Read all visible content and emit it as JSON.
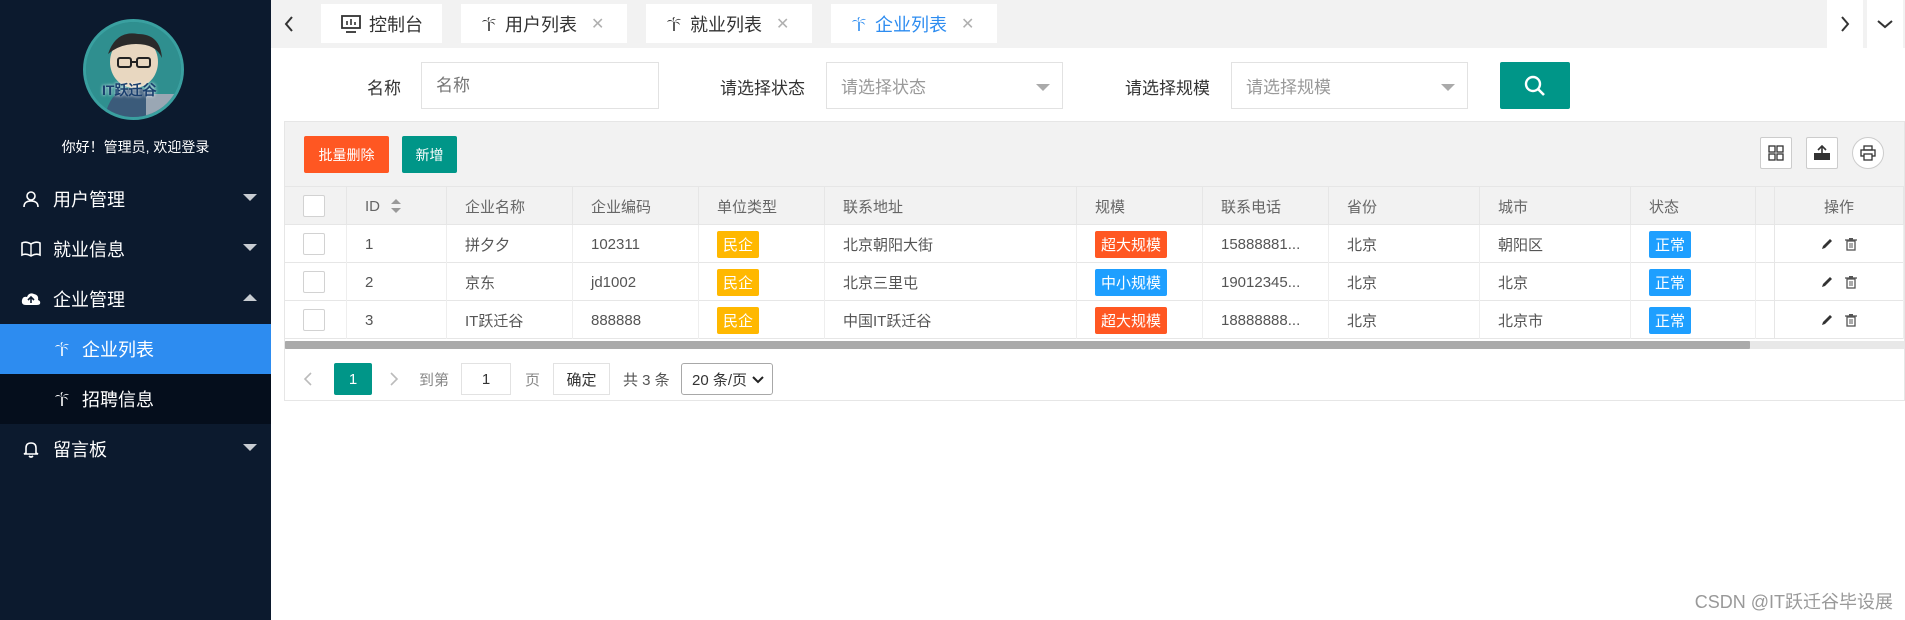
{
  "sidebar": {
    "welcome": "你好！管理员, 欢迎登录",
    "avatar_text": "IT跃迁谷",
    "menu": [
      {
        "label": "用户管理",
        "icon": "user-icon"
      },
      {
        "label": "就业信息",
        "icon": "book-icon"
      },
      {
        "label": "企业管理",
        "icon": "cloud-icon"
      },
      {
        "label": "留言板",
        "icon": "bell-icon"
      }
    ],
    "sub_items": [
      {
        "label": "企业列表",
        "icon": "palm-icon"
      },
      {
        "label": "招聘信息",
        "icon": "palm-icon"
      }
    ]
  },
  "tabs": [
    {
      "label": "控制台",
      "icon": "monitor-icon"
    },
    {
      "label": "用户列表",
      "icon": "palm-icon"
    },
    {
      "label": "就业列表",
      "icon": "palm-icon"
    },
    {
      "label": "企业列表",
      "icon": "palm-icon"
    }
  ],
  "tab_close": "✕",
  "search": {
    "name_label": "名称",
    "name_placeholder": "名称",
    "status_label": "请选择状态",
    "status_placeholder": "请选择状态",
    "scale_label": "请选择规模",
    "scale_placeholder": "请选择规模"
  },
  "toolbar": {
    "batch_delete": "批量删除",
    "add": "新增"
  },
  "table": {
    "headers": [
      "ID",
      "企业名称",
      "企业编码",
      "单位类型",
      "联系地址",
      "规模",
      "联系电话",
      "省份",
      "城市",
      "状态",
      "操作"
    ],
    "rows": [
      {
        "id": "1",
        "name": "拼夕夕",
        "code": "102311",
        "type": "民企",
        "address": "北京朝阳大街",
        "scale": "超大规模",
        "scale_color": "#ff5722",
        "phone": "15888881...",
        "province": "北京",
        "city": "朝阳区",
        "status": "正常"
      },
      {
        "id": "2",
        "name": "京东",
        "code": "jd1002",
        "type": "民企",
        "address": "北京三里屯",
        "scale": "中小规模",
        "scale_color": "#1e9fff",
        "phone": "19012345...",
        "province": "北京",
        "city": "北京",
        "status": "正常"
      },
      {
        "id": "3",
        "name": "IT跃迁谷",
        "code": "888888",
        "type": "民企",
        "address": "中国IT跃迁谷",
        "scale": "超大规模",
        "scale_color": "#ff5722",
        "phone": "18888888...",
        "province": "北京",
        "city": "北京市",
        "status": "正常"
      }
    ]
  },
  "pager": {
    "current": "1",
    "goto_label": "到第",
    "goto_value": "1",
    "page_unit": "页",
    "confirm": "确定",
    "total": "共 3 条",
    "page_size": "20 条/页"
  },
  "colors": {
    "sidebar_bg": "#0c1a2e",
    "active_blue": "#2d8cf0",
    "primary_green": "#009688",
    "danger_orange": "#ff5722",
    "warn_yellow": "#ffb800",
    "info_blue": "#1e9fff"
  },
  "watermark": "CSDN @IT跃迁谷毕设展"
}
